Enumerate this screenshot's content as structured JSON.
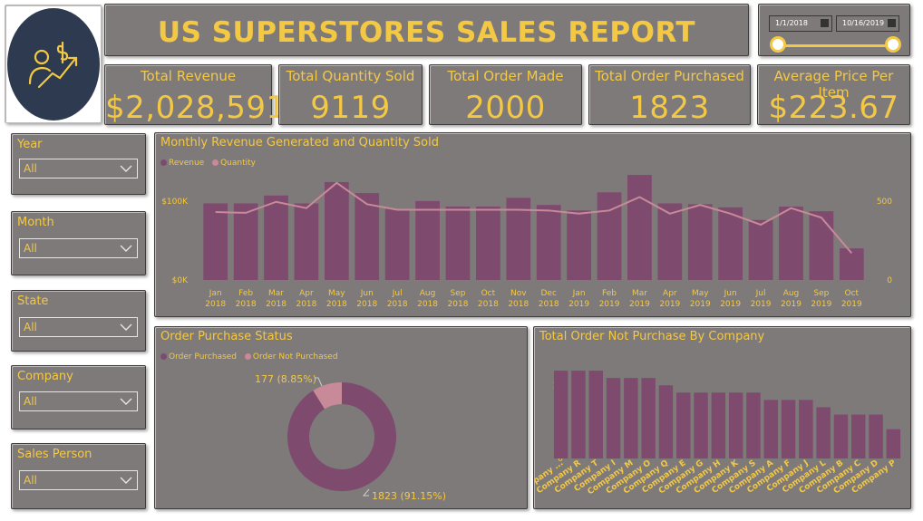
{
  "header": {
    "title": "US SUPERSTORES SALES REPORT"
  },
  "logo": {
    "icon": "person-dollar-growth-icon",
    "bg": "#2e3a4f"
  },
  "date_filter": {
    "start": "1/1/2018",
    "end": "10/16/2019"
  },
  "kpis": [
    {
      "label": "Total Revenue",
      "value": "$2,028,591"
    },
    {
      "label": "Total Quantity Sold",
      "value": "9119"
    },
    {
      "label": "Total Order Made",
      "value": "2000"
    },
    {
      "label": "Total Order Purchased",
      "value": "1823"
    },
    {
      "label": "Average Price Per Item",
      "value": "$223.67"
    }
  ],
  "slicers": [
    {
      "label": "Year",
      "value": "All"
    },
    {
      "label": "Month",
      "value": "All"
    },
    {
      "label": "State",
      "value": "All"
    },
    {
      "label": "Company",
      "value": "All"
    },
    {
      "label": "Sales Person",
      "value": "All"
    }
  ],
  "colors": {
    "accent": "#f3c844",
    "panel": "#7f7a7a",
    "bar": "#7e4a6e",
    "line": "#c88a98"
  },
  "chart_data": [
    {
      "type": "bar",
      "title": "Monthly Revenue Generated and Quantity Sold",
      "legend": [
        "Revenue",
        "Quantity"
      ],
      "legend_placement": "top-left",
      "categories": [
        "Jan 2018",
        "Feb 2018",
        "Mar 2018",
        "Apr 2018",
        "May 2018",
        "Jun 2018",
        "Jul 2018",
        "Aug 2018",
        "Sep 2018",
        "Oct 2018",
        "Nov 2018",
        "Dec 2018",
        "Jan 2019",
        "Feb 2019",
        "Mar 2019",
        "Apr 2019",
        "May 2019",
        "Jun 2019",
        "Jul 2019",
        "Aug 2019",
        "Sep 2019",
        "Oct 2019"
      ],
      "series": [
        {
          "name": "Revenue",
          "axis": "left",
          "values": [
            97000,
            97000,
            107000,
            97000,
            124000,
            110000,
            90000,
            100000,
            93000,
            93000,
            104000,
            95000,
            88000,
            111000,
            133000,
            97000,
            96000,
            92000,
            76000,
            93000,
            87000,
            40000
          ]
        },
        {
          "name": "Quantity",
          "axis": "right",
          "values": [
            430,
            425,
            495,
            455,
            615,
            480,
            445,
            445,
            445,
            445,
            445,
            440,
            420,
            440,
            525,
            420,
            475,
            420,
            350,
            455,
            395,
            170
          ]
        }
      ],
      "y_ticks": [
        "$0K",
        "$100K"
      ],
      "y2_ticks": [
        "0",
        "500"
      ],
      "ylim": [
        0,
        140000
      ],
      "y2lim": [
        0,
        700
      ],
      "grid": false
    },
    {
      "type": "pie",
      "title": "Order Purchase Status",
      "legend_placement": "top-left",
      "slices": [
        {
          "name": "Order Purchased",
          "value": 1823,
          "label": "1823 (91.15%)"
        },
        {
          "name": "Order Not Purchased",
          "value": 177,
          "label": "177 (8.85%)"
        }
      ]
    },
    {
      "type": "bar",
      "title": "Total Order Not Purchase By Company",
      "categories": [
        "Company ...",
        "Company R",
        "Company T",
        "Company I",
        "Company M",
        "Company O",
        "Company Q",
        "Company E",
        "Company G",
        "Company H",
        "Company K",
        "Company S",
        "Company A",
        "Company F",
        "Company J",
        "Company L",
        "Company B",
        "Company C",
        "Company D",
        "Company P"
      ],
      "values": [
        12,
        12,
        12,
        11,
        11,
        11,
        10,
        9,
        9,
        9,
        9,
        9,
        8,
        8,
        8,
        7,
        6,
        6,
        6,
        4
      ],
      "y_ticks": [
        "0",
        "10"
      ],
      "ylim": [
        0,
        13
      ],
      "grid": false
    }
  ]
}
